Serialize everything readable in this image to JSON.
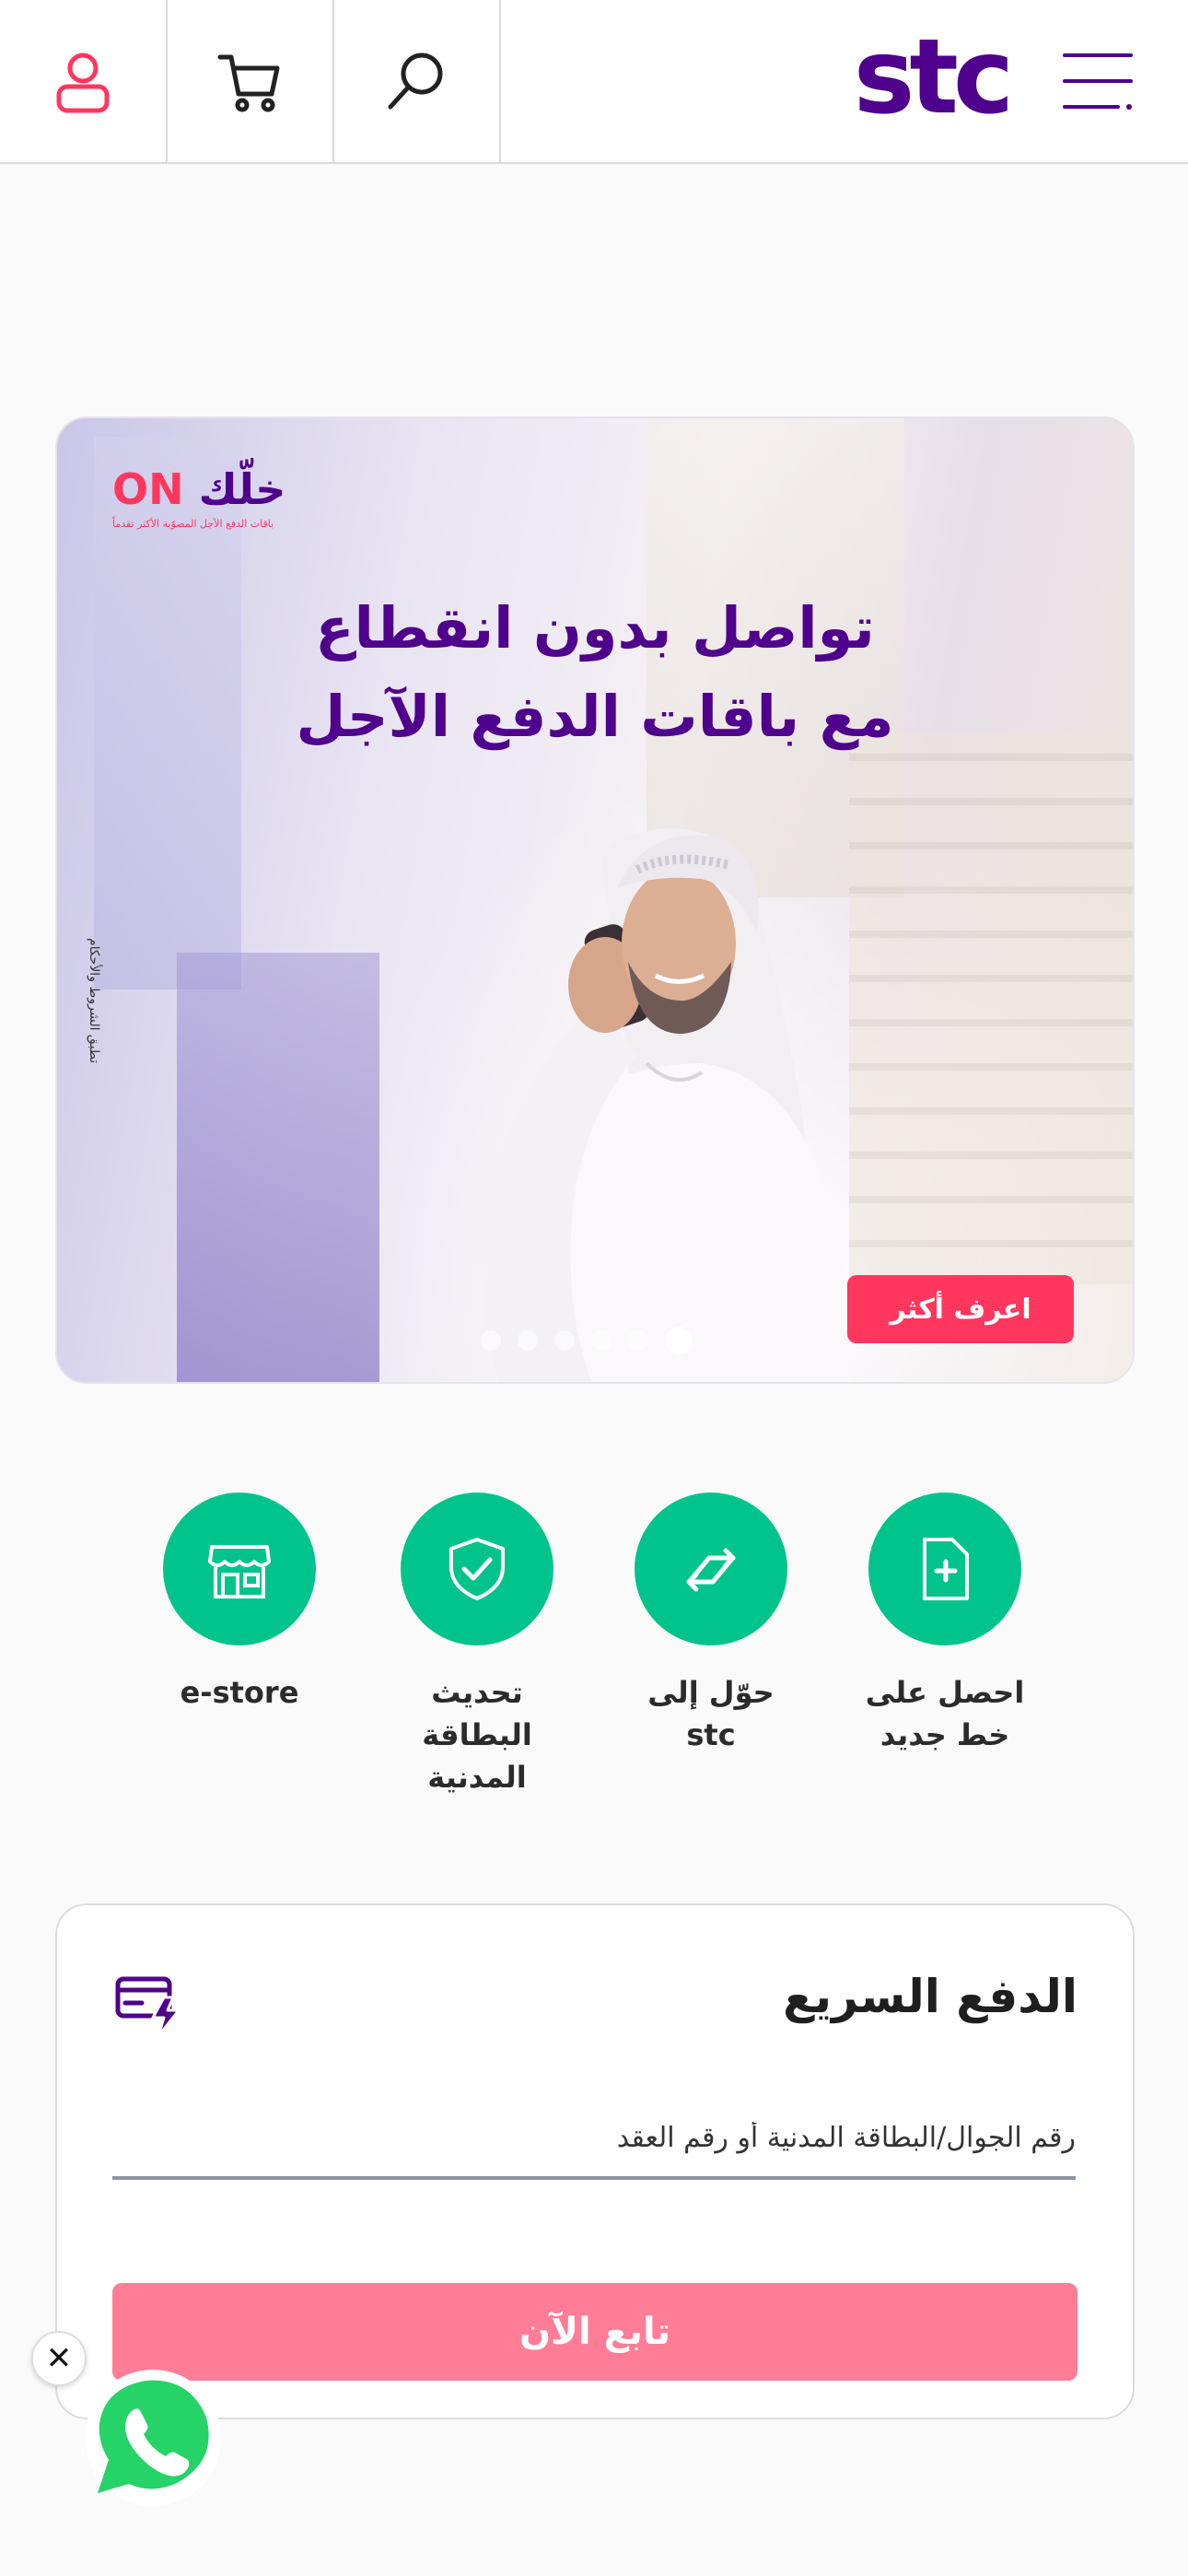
{
  "header": {
    "logo_text": "stc",
    "icons": [
      "profile-icon",
      "cart-icon",
      "search-icon",
      "menu-icon"
    ]
  },
  "banner": {
    "brand_word": "خلّك",
    "brand_on": "ON",
    "brand_tagline": "باقات الدفع الآجل المصوّبة الأكثر تقدماً",
    "headline_line1": "تواصل بدون انقطاع",
    "headline_line2": "مع باقات الدفع الآجل",
    "terms": "تطبق الشروط والأحكام",
    "cta": "اعرف أكثر",
    "slide_count": 6,
    "active_slide": 6
  },
  "quick_links": [
    {
      "label": "e-store",
      "icon": "store-icon"
    },
    {
      "label": "تحديث البطاقة المدنية",
      "icon": "shield-check-icon"
    },
    {
      "label": "حوّل إلى stc",
      "icon": "switch-arrows-icon"
    },
    {
      "label": "احصل على خط جديد",
      "icon": "new-sim-icon"
    }
  ],
  "quick_pay": {
    "title": "الدفع السريع",
    "icon": "card-flash-icon",
    "input_placeholder": "رقم الجوال/البطاقة المدنية أو رقم العقد",
    "button": "تابع الآن"
  },
  "floating": {
    "close_symbol": "✕",
    "whatsapp_icon": "whatsapp-icon"
  },
  "colors": {
    "brand_purple": "#4f008c",
    "brand_pink": "#ff375e",
    "green": "#00c48c",
    "button_disabled_pink": "#ff7d96"
  }
}
